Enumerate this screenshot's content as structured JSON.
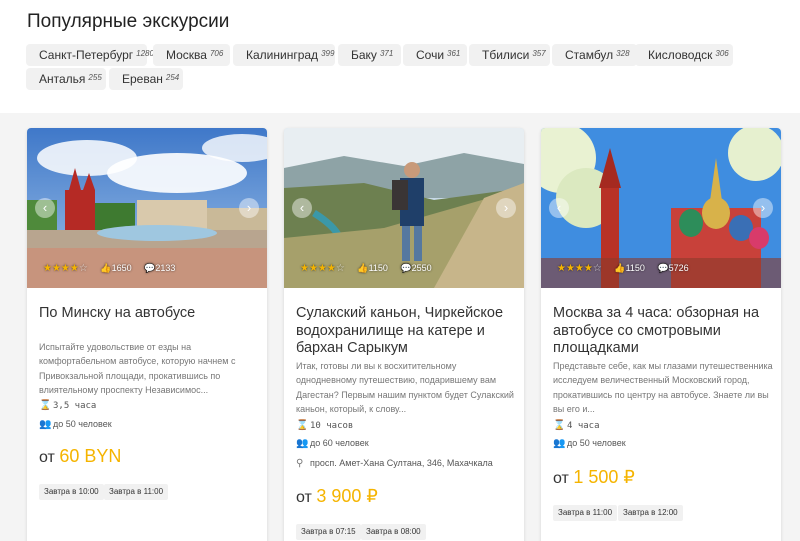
{
  "page_title": "Популярные экскурсии",
  "cities": [
    {
      "name": "Санкт-Петербург",
      "count": "1280"
    },
    {
      "name": "Москва",
      "count": "706"
    },
    {
      "name": "Калининград",
      "count": "399"
    },
    {
      "name": "Баку",
      "count": "371"
    },
    {
      "name": "Сочи",
      "count": "361"
    },
    {
      "name": "Тбилиси",
      "count": "357"
    },
    {
      "name": "Стамбул",
      "count": "328"
    },
    {
      "name": "Кисловодск",
      "count": "306"
    },
    {
      "name": "Анталья",
      "count": "255"
    },
    {
      "name": "Ереван",
      "count": "254"
    }
  ],
  "tours": [
    {
      "title": "По Минску на автобусе",
      "description": "Испытайте удовольствие от езды на комфортабельном автобусе, которую начнем с Привокзальной площади, прокатившись по влиятельному проспекту Независимос...",
      "duration": "3,5 часа",
      "group": "до 50 человек",
      "price_prefix": "от",
      "price": "60 BYN",
      "rating_stars": 4.5,
      "likes": "1650",
      "reviews": "2133",
      "slots": [
        "Завтра в 10:00",
        "Завтра в 11:00"
      ]
    },
    {
      "title": "Сулакский каньон, Чиркейское водохранилище на катере и бархан Сарыкум",
      "description": "Итак, готовы ли вы к восхитительному однодневному путешествию, подарившему вам Дагестан? Первым нашим пунктом будет Сулакский каньон, который, к слову...",
      "duration": "10 часов",
      "group": "до 60 человек",
      "address": "просп. Амет-Хана Султана, 346, Махачкала",
      "price_prefix": "от",
      "price": "3 900 ₽",
      "rating_stars": 4.5,
      "likes": "1150",
      "reviews": "2550",
      "slots": [
        "Завтра в 07:15",
        "Завтра в 08:00"
      ]
    },
    {
      "title": "Москва за 4 часа: обзорная на автобусе со смотровыми площадками",
      "description": "Представьте себе, как мы глазами путешественника исследуем величественный Московский город, прокатившись по центру на автобусе. Знаете ли вы вы его и...",
      "duration": "4 часа",
      "group": "до 50 человек",
      "price_prefix": "от",
      "price": "1 500 ₽",
      "rating_stars": 4.5,
      "likes": "1150",
      "reviews": "5726",
      "slots": [
        "Завтра в 11:00",
        "Завтра в 12:00"
      ]
    }
  ],
  "colors": {
    "accent": "#f5b400",
    "chip_bg": "#f1f1f1",
    "card_bg": "#ffffff",
    "page_bg": "#f4f4f4"
  },
  "icons": {
    "duration": "hourglass-icon",
    "group": "people-icon",
    "address": "location-pin-icon",
    "likes": "thumb-up-icon",
    "reviews": "chat-icon",
    "prev": "chevron-left-icon",
    "next": "chevron-right-icon"
  }
}
